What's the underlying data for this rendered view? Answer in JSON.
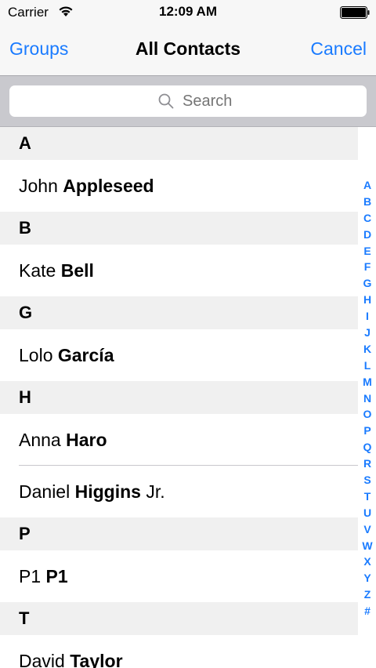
{
  "status_bar": {
    "carrier": "Carrier",
    "time": "12:09 AM",
    "wifi_icon": "wifi-icon",
    "battery_icon": "battery-icon"
  },
  "nav": {
    "left_label": "Groups",
    "title": "All Contacts",
    "right_label": "Cancel"
  },
  "search": {
    "placeholder": "Search",
    "value": ""
  },
  "sections": [
    {
      "header": "A",
      "contacts": [
        {
          "first": "John",
          "last": "Appleseed",
          "suffix": ""
        }
      ]
    },
    {
      "header": "B",
      "contacts": [
        {
          "first": "Kate",
          "last": "Bell",
          "suffix": ""
        }
      ]
    },
    {
      "header": "G",
      "contacts": [
        {
          "first": "Lolo",
          "last": "García",
          "suffix": ""
        }
      ]
    },
    {
      "header": "H",
      "contacts": [
        {
          "first": "Anna",
          "last": "Haro",
          "suffix": ""
        },
        {
          "first": "Daniel",
          "last": "Higgins",
          "suffix": "Jr."
        }
      ]
    },
    {
      "header": "P",
      "contacts": [
        {
          "first": "P1",
          "last": "P1",
          "suffix": ""
        }
      ]
    },
    {
      "header": "T",
      "contacts": [
        {
          "first": "David",
          "last": "Taylor",
          "suffix": ""
        }
      ]
    }
  ],
  "index_letters": [
    "A",
    "B",
    "C",
    "D",
    "E",
    "F",
    "G",
    "H",
    "I",
    "J",
    "K",
    "L",
    "M",
    "N",
    "O",
    "P",
    "Q",
    "R",
    "S",
    "T",
    "U",
    "V",
    "W",
    "X",
    "Y",
    "Z",
    "#"
  ],
  "colors": {
    "accent": "#1a7bff",
    "section_bg": "#f0f0f0",
    "search_bar_bg": "#c9c9ce"
  }
}
